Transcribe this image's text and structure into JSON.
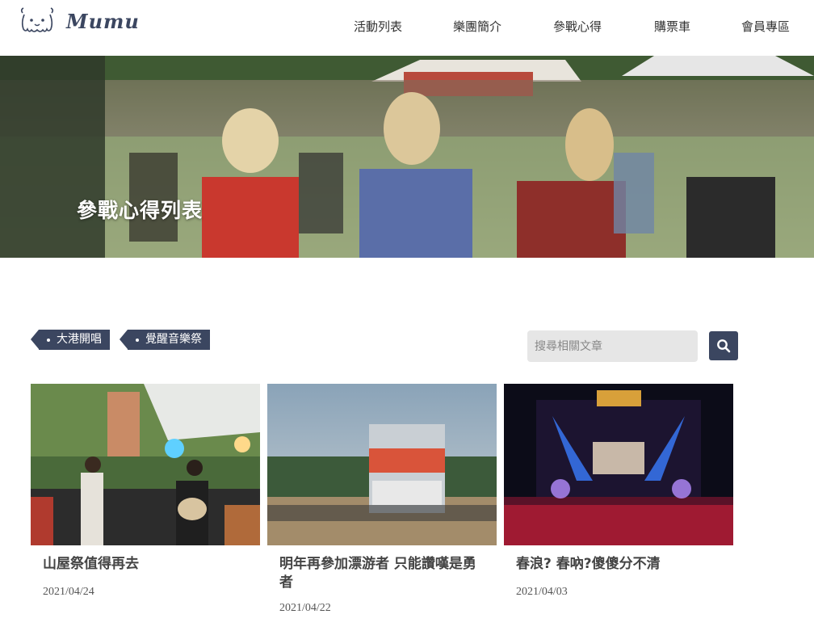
{
  "brand": {
    "name": "Mumu",
    "logo_icon": "ghost-face-logo-icon"
  },
  "nav": {
    "items": [
      {
        "label": "活動列表"
      },
      {
        "label": "樂團簡介"
      },
      {
        "label": "參戰心得"
      },
      {
        "label": "購票車"
      },
      {
        "label": "會員專區"
      }
    ]
  },
  "hero": {
    "title": "參戰心得列表"
  },
  "tags": [
    {
      "label": "大港開唱"
    },
    {
      "label": "覺醒音樂祭"
    }
  ],
  "search": {
    "placeholder": "搜尋相關文章",
    "icon": "search-icon"
  },
  "articles": [
    {
      "title": "山屋祭值得再去",
      "date": "2021/04/24"
    },
    {
      "title": "明年再參加漂游者 只能讚嘆是勇者",
      "date": "2021/04/22"
    },
    {
      "title": "春浪? 春吶?傻傻分不清",
      "date": "2021/04/03"
    }
  ],
  "colors": {
    "accent": "#3b4660",
    "search_bg": "#e6e6e6"
  }
}
